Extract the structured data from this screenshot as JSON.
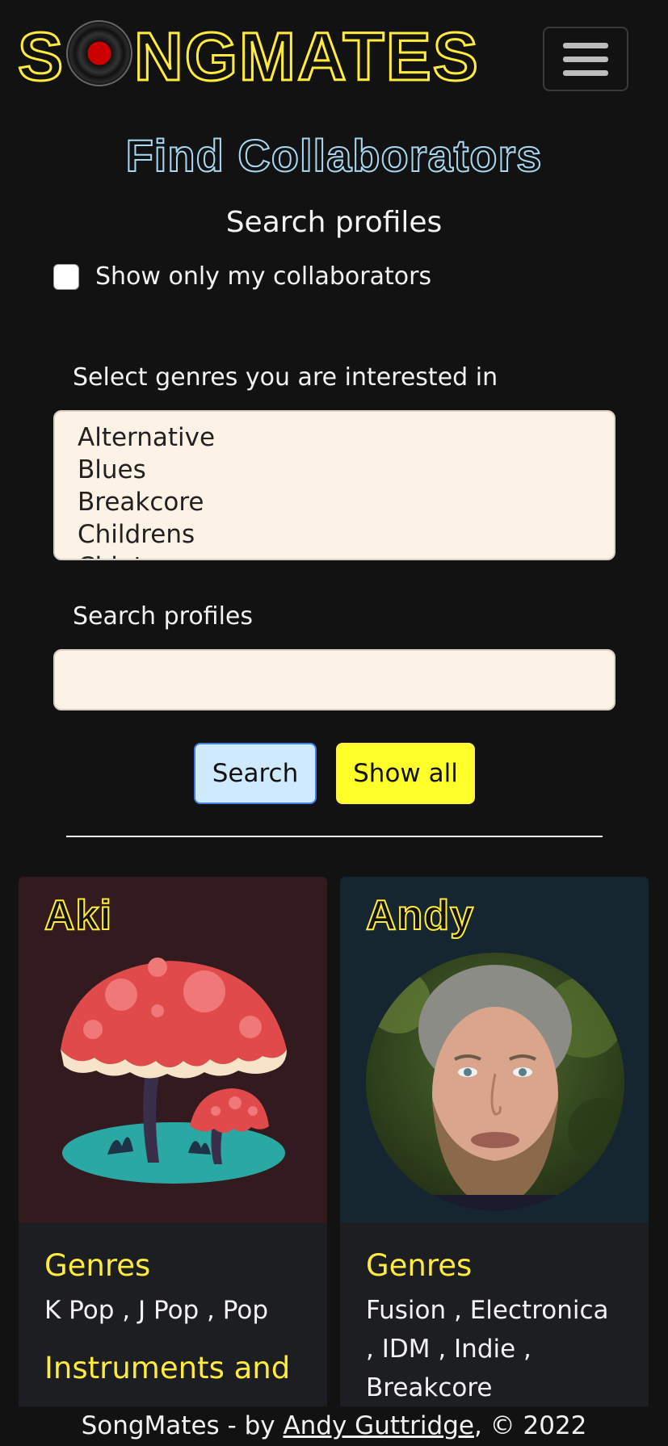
{
  "navbar": {
    "brand_before": "S",
    "brand_after": "NGMATES",
    "brand_full": "SongMates"
  },
  "page": {
    "title": "Find Collaborators",
    "subtitle": "Search profiles"
  },
  "filters": {
    "collaborators_checkbox_label": "Show only my collaborators",
    "collaborators_checked": false,
    "genres_label": "Select genres you are interested in",
    "genres_options": [
      "Alternative",
      "Blues",
      "Breakcore",
      "Childrens",
      "Chiptune"
    ],
    "search_label": "Search profiles",
    "search_value": ""
  },
  "buttons": {
    "search": "Search",
    "show_all": "Show all"
  },
  "profiles": [
    {
      "name": "Aki",
      "genres_title": "Genres",
      "genres": "K Pop , J Pop , Pop",
      "instruments_title": "Instruments and"
    },
    {
      "name": "Andy",
      "genres_title": "Genres",
      "genres": "Fusion , Electronica , IDM , Indie , Breakcore"
    }
  ],
  "footer": {
    "prefix": "SongMates - by ",
    "author": "Andy Guttridge",
    "suffix": ", © 2022"
  },
  "colors": {
    "accent_yellow": "#ffeb3b",
    "title_blue": "#a9d8f2",
    "card_a_bg": "#331a1e",
    "card_b_bg": "#162630"
  }
}
